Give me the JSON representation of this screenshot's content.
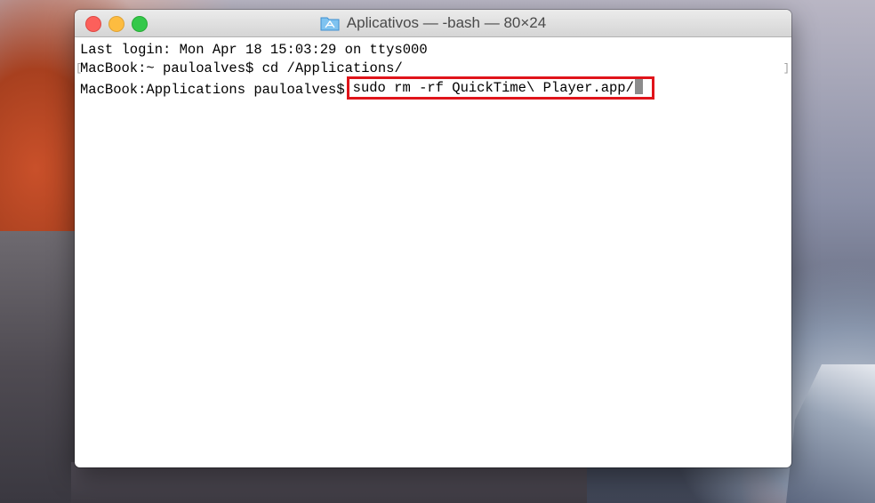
{
  "window": {
    "title": "Aplicativos — -bash — 80×24",
    "title_icon": "folder-icon"
  },
  "terminal": {
    "line1": "Last login: Mon Apr 18 15:03:29 on ttys000",
    "line2": "MacBook:~ pauloalves$ cd /Applications/",
    "line3_prompt": "MacBook:Applications pauloalves$",
    "line3_command": "sudo rm -rf QuickTime\\ Player.app/"
  },
  "colors": {
    "highlight_box": "#e0141a",
    "close": "#fc605b",
    "minimize": "#fdbc40",
    "maximize": "#34c84a"
  }
}
